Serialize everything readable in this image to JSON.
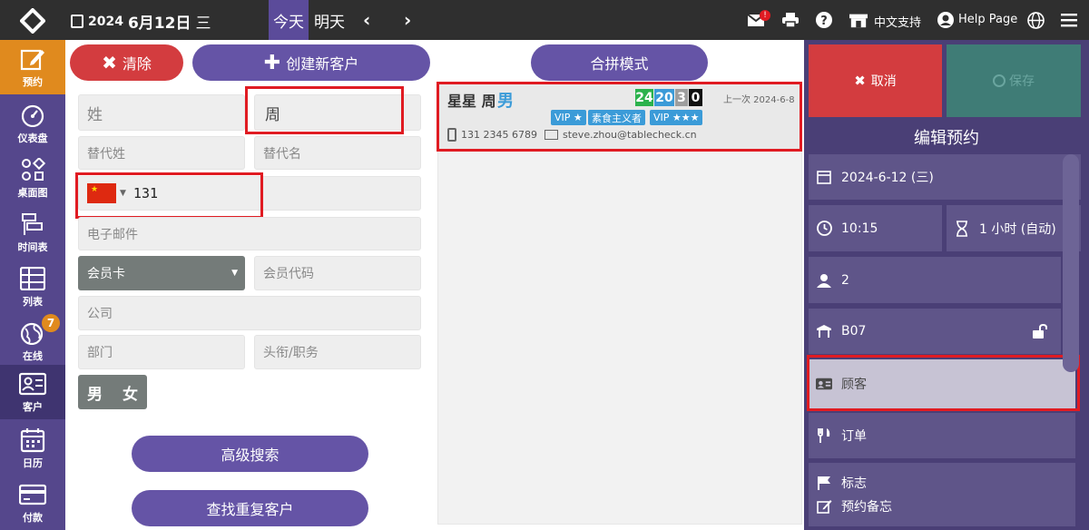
{
  "topbar": {
    "year": "2024",
    "monthday": "6月12日",
    "weekday": "三",
    "today": "今天",
    "tomorrow": "明天",
    "prev_arrow": "‹",
    "next_arrow": "›",
    "mail_badge": "!",
    "language_support": "中文支持",
    "help_page": "Help Page"
  },
  "nav": [
    {
      "label": "预约"
    },
    {
      "label": "仪表盘"
    },
    {
      "label": "桌面图"
    },
    {
      "label": "时间表"
    },
    {
      "label": "列表"
    },
    {
      "label": "在线",
      "badge": "7"
    },
    {
      "label": "客户"
    },
    {
      "label": "日历"
    },
    {
      "label": "付款"
    }
  ],
  "left": {
    "clear_btn": "清除",
    "create_btn": "创建新客户",
    "merge_btn": "合拼模式",
    "adv_search": "高级搜索",
    "dup_search": "查找重复客户"
  },
  "form": {
    "last_name_ph": "姓",
    "first_name_value": "周",
    "alt_last_ph": "替代姓",
    "alt_first_ph": "替代名",
    "phone_value": "131",
    "email_ph": "电子邮件",
    "member_card": "会员卡",
    "member_code_ph": "会员代码",
    "company_ph": "公司",
    "dept_ph": "部门",
    "title_ph": "头衔/职务",
    "male": "男",
    "female": "女"
  },
  "result": {
    "name": "星星 周",
    "gender": "男",
    "scores": [
      "24",
      "20",
      "3",
      "0"
    ],
    "score_colors": [
      "#2bb24c",
      "#3b9bd8",
      "#9e9e9e",
      "#111111"
    ],
    "last_visit": "上一次 2024-6-8",
    "tags": [
      "VIP ★",
      "素食主义者",
      "VIP ★★★"
    ],
    "phone": "131 2345 6789",
    "email": "steve.zhou@tablecheck.cn"
  },
  "right": {
    "cancel": "取消",
    "save": "保存",
    "title": "编辑预约",
    "date": "2024-6-12 (三)",
    "time": "10:15",
    "duration": "1 小时 (自动)",
    "guests": "2",
    "table": "B07",
    "customer": "顾客",
    "order": "订单",
    "flag": "标志",
    "memo": "预约备忘"
  },
  "colors": {
    "accent_purple": "#6554a6",
    "nav_active": "#e08a1e",
    "danger_red": "#d33c3f",
    "highlight": "#e01b22"
  }
}
